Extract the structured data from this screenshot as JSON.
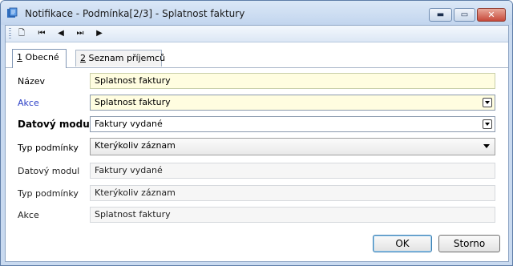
{
  "window": {
    "title": "Notifikace - Podmínka[2/3] - Splatnost faktury"
  },
  "window_buttons": {
    "minimize": "▬",
    "maximize": "▭",
    "close": "✕"
  },
  "toolbar": {
    "new": "🗋",
    "first": "⏮",
    "prev": "◀",
    "next": "⏭",
    "play": "▶"
  },
  "tabs": [
    {
      "key": "1",
      "label": " Obecné"
    },
    {
      "key": "2",
      "label": " Seznam příjemců"
    }
  ],
  "form": {
    "nazev": {
      "label": "Název",
      "value": "Splatnost faktury"
    },
    "akce": {
      "label": "Akce",
      "value": "Splatnost faktury"
    },
    "datovy_modul": {
      "label": "Datový modul",
      "value": "Faktury vydané"
    },
    "typ_podminky": {
      "label": "Typ podmínky",
      "value": "Kterýkoliv záznam"
    }
  },
  "readonly": {
    "datovy_modul": {
      "label": "Datový modul",
      "value": "Faktury vydané"
    },
    "typ_podminky": {
      "label": "Typ podmínky",
      "value": "Kterýkoliv záznam"
    },
    "akce": {
      "label": "Akce",
      "value": "Splatnost faktury"
    }
  },
  "buttons": {
    "ok": "OK",
    "cancel": "Storno"
  }
}
